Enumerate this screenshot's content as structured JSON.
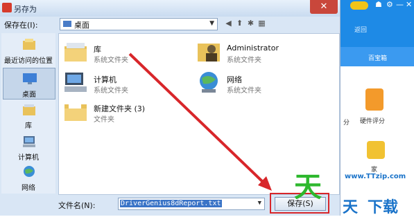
{
  "dialog": {
    "title": "另存为",
    "close": "✕",
    "save_in_label": "保存在(I):",
    "save_in_value": "桌面",
    "file_name_label": "文件名(N):",
    "file_name_value": "DriverGenius8dReport.txt",
    "save_button": "保存(S)"
  },
  "places": [
    {
      "label": "最近访问的位置",
      "icon": "recent-icon"
    },
    {
      "label": "桌面",
      "icon": "desktop-icon",
      "selected": true
    },
    {
      "label": "库",
      "icon": "library-icon"
    },
    {
      "label": "计算机",
      "icon": "computer-icon"
    },
    {
      "label": "网络",
      "icon": "network-icon"
    }
  ],
  "files": [
    {
      "name": "库",
      "desc": "系统文件夹",
      "icon": "library-folder-icon"
    },
    {
      "name": "Administrator",
      "desc": "系统文件夹",
      "icon": "user-folder-icon"
    },
    {
      "name": "计算机",
      "desc": "系统文件夹",
      "icon": "computer-icon"
    },
    {
      "name": "网络",
      "desc": "系统文件夹",
      "icon": "network-icon"
    },
    {
      "name": "新建文件夹 (3)",
      "desc": "文件夹",
      "icon": "folder-icon"
    }
  ],
  "right_app": {
    "back": "返回",
    "tab": "百宝箱",
    "hardware_score": "硬件评分",
    "side_label": "分",
    "bottom_label": "家"
  },
  "watermark": {
    "url": "www.TTzip.com",
    "big": "天",
    "mid1": "天",
    "mid2": "下载"
  },
  "colors": {
    "highlight_red": "#d8262a",
    "title_bar_blue": "#c9dbf0",
    "app_blue": "#1e8ae6",
    "watermark_green": "#2eb82e"
  }
}
